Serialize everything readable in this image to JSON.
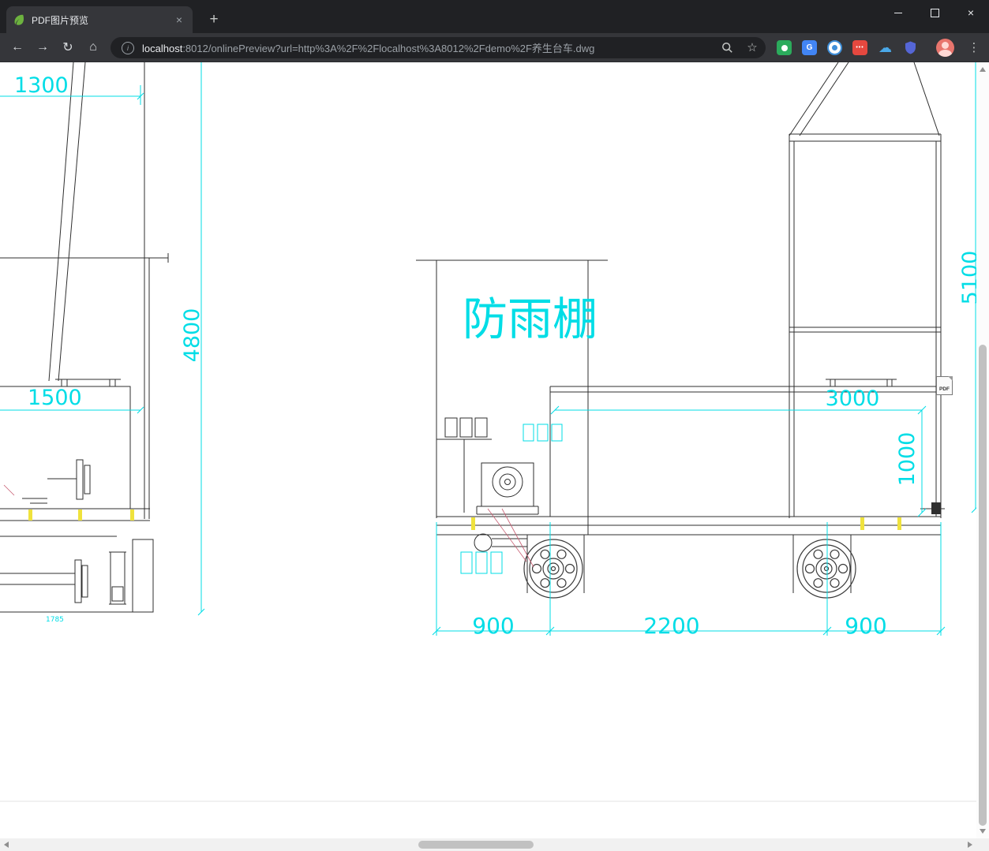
{
  "browser": {
    "tab_title": "PDF图片预览",
    "url_host": "localhost",
    "url_rest": ":8012/onlinePreview?url=http%3A%2F%2Flocalhost%3A8012%2Fdemo%2F养生台车.dwg"
  },
  "icons": {
    "back": "←",
    "forward": "→",
    "reload": "↻",
    "home": "⌂",
    "info": "i",
    "star": "☆",
    "new_tab": "+",
    "close_tab": "×",
    "close_window": "×",
    "menu": "⋮",
    "cloud": "☁",
    "translate": "G"
  },
  "drawing": {
    "shelter_label": "防雨棚",
    "dims": {
      "d1300": "1300",
      "d4800": "4800",
      "d1500": "1500",
      "d1785": "1785",
      "d900_left": "900",
      "d2200": "2200",
      "d900_right": "900",
      "d3000": "3000",
      "d1000": "1000",
      "d5100": "5100"
    },
    "pdf_icon": "PDF",
    "colors": {
      "dimension": "#00dde6",
      "line": "#2f2f2f",
      "highlight": "#efe23d",
      "leader": "#c75d72"
    }
  }
}
